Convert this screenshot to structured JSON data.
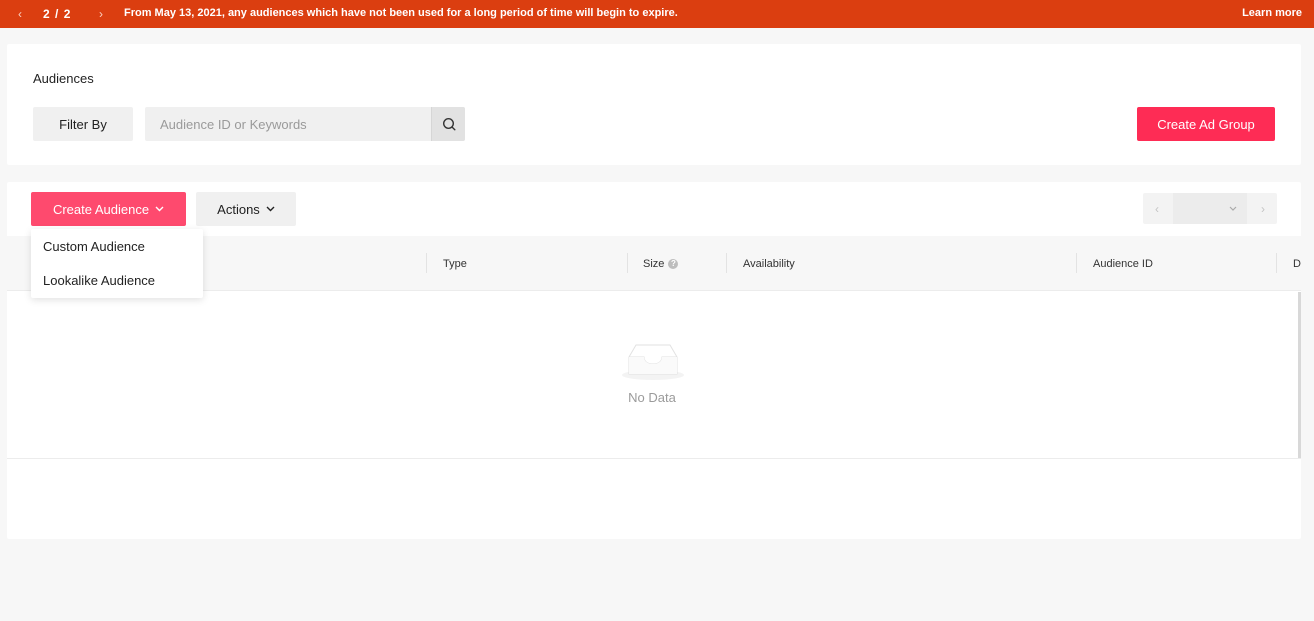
{
  "banner": {
    "prev_icon": "chevron-left-icon",
    "current": "2",
    "separator": "/",
    "total": "2",
    "next_icon": "chevron-right-icon",
    "message": "From May 13, 2021, any audiences which have not been used for a long period of time will begin to expire.",
    "learn_more": "Learn more",
    "color": "#db3e10"
  },
  "header": {
    "title": "Audiences",
    "filter_label": "Filter By",
    "search_placeholder": "Audience ID or Keywords",
    "search_icon": "search-icon",
    "create_ad_group_label": "Create Ad Group",
    "accent_color": "#fe2c55"
  },
  "toolbar": {
    "create_audience_label": "Create Audience",
    "actions_label": "Actions",
    "pagination_prev_icon": "chevron-left-icon",
    "pagination_next_icon": "chevron-right-icon",
    "page_size_icon": "chevron-down-icon"
  },
  "dropdown": {
    "items": [
      {
        "label": "Custom Audience"
      },
      {
        "label": "Lookalike Audience"
      }
    ]
  },
  "table": {
    "columns": [
      {
        "label": "Type"
      },
      {
        "label": "Size",
        "help": "?"
      },
      {
        "label": "Availability"
      },
      {
        "label": "Audience ID"
      },
      {
        "label": "D"
      }
    ],
    "empty_text": "No Data",
    "empty_icon": "inbox-icon"
  }
}
